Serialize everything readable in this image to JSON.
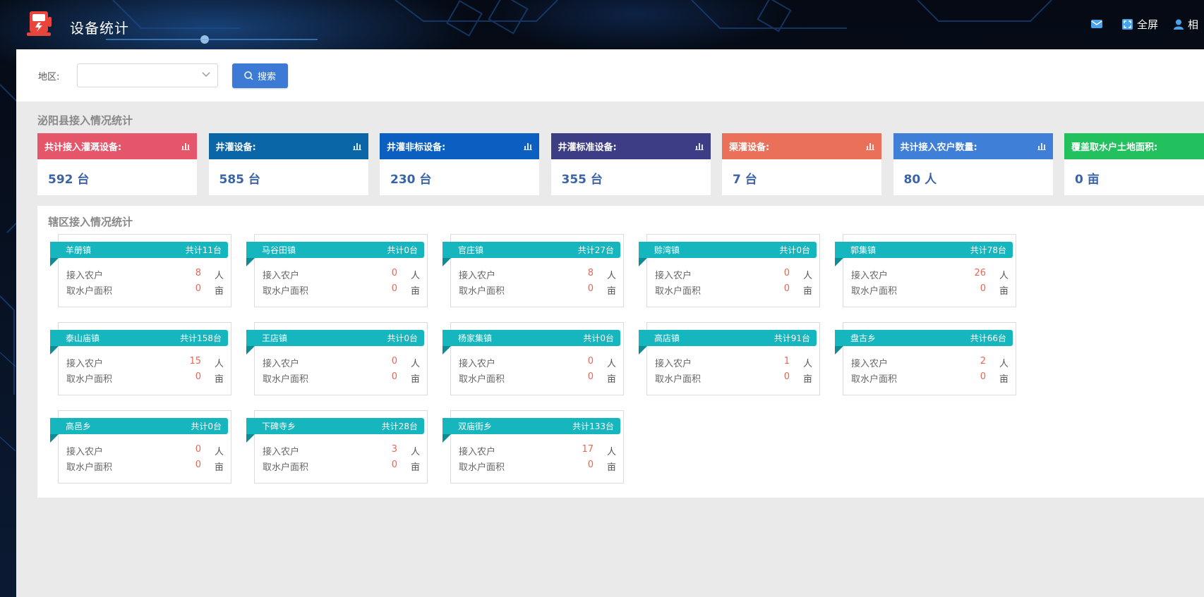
{
  "header": {
    "title": "设备统计",
    "right_items": [
      {
        "icon": "message-icon",
        "label": ""
      },
      {
        "icon": "fullscreen-icon",
        "label": "全屏"
      },
      {
        "icon": "user-icon",
        "label": "相"
      }
    ]
  },
  "search": {
    "region_label": "地区:",
    "region_value": "",
    "button_label": "搜索"
  },
  "county": {
    "title": "泌阳县接入情况统计",
    "cards": [
      {
        "label": "共计接入灌溉设备:",
        "value": "592 台",
        "color": "#e5566b",
        "icon": "bar-chart-icon"
      },
      {
        "label": "井灌设备:",
        "value": "585 台",
        "color": "#0a66a6",
        "icon": "bar-chart-icon"
      },
      {
        "label": "井灌非标设备:",
        "value": "230 台",
        "color": "#0a5fc0",
        "icon": "bar-chart-icon"
      },
      {
        "label": "井灌标准设备:",
        "value": "355 台",
        "color": "#3d3d86",
        "icon": "bar-chart-icon"
      },
      {
        "label": "渠灌设备:",
        "value": "7 台",
        "color": "#ea705a",
        "icon": "bar-chart-icon"
      },
      {
        "label": "共计接入农户数量:",
        "value": "80 人",
        "color": "#3f7fd8",
        "icon": "bar-chart-icon"
      },
      {
        "label": "覆盖取水户土地面积:",
        "value": "0 亩",
        "color": "#23c05e",
        "icon": "bar-chart-icon"
      }
    ]
  },
  "district": {
    "title": "辖区接入情况统计",
    "row_labels": {
      "farmers": "接入农户",
      "area": "取水户面积"
    },
    "units": {
      "farmers": "人",
      "area": "亩"
    },
    "towns": [
      {
        "name": "羊册镇",
        "total": "共计11台",
        "farmers": "8",
        "area": "0"
      },
      {
        "name": "马谷田镇",
        "total": "共计0台",
        "farmers": "0",
        "area": "0"
      },
      {
        "name": "官庄镇",
        "total": "共计27台",
        "farmers": "8",
        "area": "0"
      },
      {
        "name": "赊湾镇",
        "total": "共计0台",
        "farmers": "0",
        "area": "0"
      },
      {
        "name": "郭集镇",
        "total": "共计78台",
        "farmers": "26",
        "area": "0"
      },
      {
        "name": "泰山庙镇",
        "total": "共计158台",
        "farmers": "15",
        "area": "0"
      },
      {
        "name": "王店镇",
        "total": "共计0台",
        "farmers": "0",
        "area": "0"
      },
      {
        "name": "杨家集镇",
        "total": "共计0台",
        "farmers": "0",
        "area": "0"
      },
      {
        "name": "高店镇",
        "total": "共计91台",
        "farmers": "1",
        "area": "0"
      },
      {
        "name": "盘古乡",
        "total": "共计66台",
        "farmers": "2",
        "area": "0"
      },
      {
        "name": "高邑乡",
        "total": "共计0台",
        "farmers": "0",
        "area": "0"
      },
      {
        "name": "下碑寺乡",
        "total": "共计28台",
        "farmers": "3",
        "area": "0"
      },
      {
        "name": "双庙街乡",
        "total": "共计133台",
        "farmers": "17",
        "area": "0"
      }
    ]
  }
}
